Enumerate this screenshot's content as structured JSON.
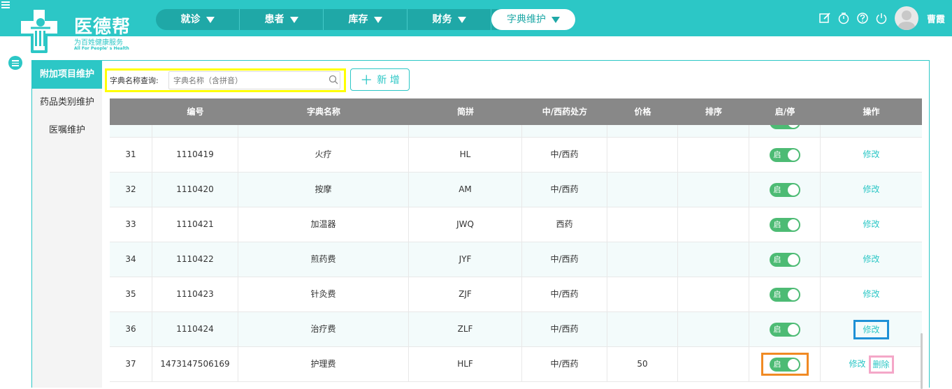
{
  "header": {
    "logo_name": "医德帮",
    "logo_tagline": "为百姓健康服务",
    "logo_tagline_en": "All For People' s Health",
    "nav": [
      {
        "label": "就诊",
        "active": false
      },
      {
        "label": "患者",
        "active": false
      },
      {
        "label": "库存",
        "active": false
      },
      {
        "label": "财务",
        "active": false
      },
      {
        "label": "字典维护",
        "active": true
      }
    ],
    "icons": [
      "edit-icon",
      "timer-icon",
      "help-icon",
      "power-icon"
    ],
    "username": "曹霞"
  },
  "sidebar": {
    "items": [
      {
        "label": "附加项目维护",
        "active": true
      },
      {
        "label": "药品类别维护",
        "active": false
      },
      {
        "label": "医嘱维护",
        "active": false
      }
    ]
  },
  "search": {
    "label": "字典名称查询:",
    "placeholder": "字典名称（含拼音）"
  },
  "add_button": {
    "label": "新 增"
  },
  "table": {
    "columns": [
      "编号",
      "字典名称",
      "简拼",
      "中/西药处方",
      "价格",
      "排序",
      "启/停",
      "操作"
    ],
    "rows": [
      {
        "index": "31",
        "code": "1110419",
        "name": "火疗",
        "pinyin": "HL",
        "type": "中/西药",
        "price": "",
        "order": "",
        "status": "启",
        "edit": "修改",
        "delete": ""
      },
      {
        "index": "32",
        "code": "1110420",
        "name": "按摩",
        "pinyin": "AM",
        "type": "中/西药",
        "price": "",
        "order": "",
        "status": "启",
        "edit": "修改",
        "delete": ""
      },
      {
        "index": "33",
        "code": "1110421",
        "name": "加温器",
        "pinyin": "JWQ",
        "type": "西药",
        "price": "",
        "order": "",
        "status": "启",
        "edit": "修改",
        "delete": ""
      },
      {
        "index": "34",
        "code": "1110422",
        "name": "煎药费",
        "pinyin": "JYF",
        "type": "中/西药",
        "price": "",
        "order": "",
        "status": "启",
        "edit": "修改",
        "delete": ""
      },
      {
        "index": "35",
        "code": "1110423",
        "name": "针灸费",
        "pinyin": "ZJF",
        "type": "中/西药",
        "price": "",
        "order": "",
        "status": "启",
        "edit": "修改",
        "delete": ""
      },
      {
        "index": "36",
        "code": "1110424",
        "name": "治疗费",
        "pinyin": "ZLF",
        "type": "中/西药",
        "price": "",
        "order": "",
        "status": "启",
        "edit": "修改",
        "delete": ""
      },
      {
        "index": "37",
        "code": "1473147506169",
        "name": "护理费",
        "pinyin": "HLF",
        "type": "中/西药",
        "price": "50",
        "order": "",
        "status": "启",
        "edit": "修改",
        "delete": "删除"
      }
    ]
  },
  "colors": {
    "brand": "#2cc7c6",
    "toggle_on": "#4dbb74",
    "header_row": "#888888"
  }
}
